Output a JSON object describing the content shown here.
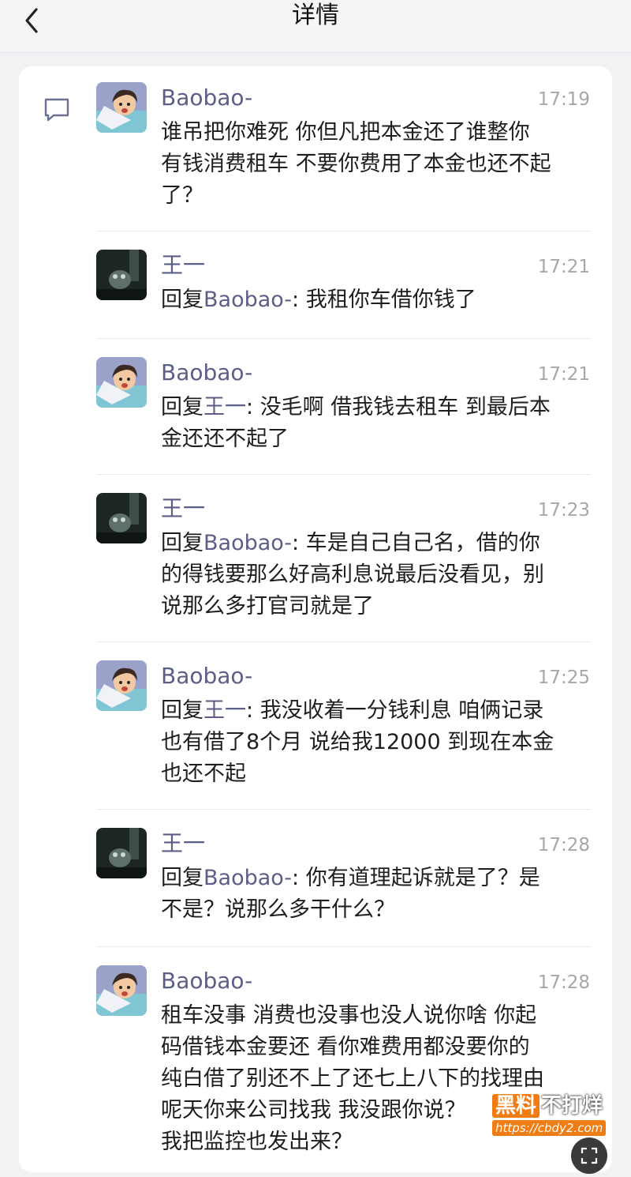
{
  "header": {
    "title": "详情"
  },
  "messages": [
    {
      "sender": "Baobao-",
      "time": "17:19",
      "avatar": "baobao",
      "reply_prefix": "",
      "reply_target": "",
      "reply_sep": "",
      "text": "谁吊把你难死 你但凡把本金还了谁整你\n有钱消费租车 不要你费用了本金也还不起\n了？"
    },
    {
      "sender": "王一",
      "time": "17:21",
      "avatar": "wangyi",
      "reply_prefix": "回复",
      "reply_target": "Baobao-",
      "reply_sep": ": ",
      "text": "我租你车借你钱了"
    },
    {
      "sender": "Baobao-",
      "time": "17:21",
      "avatar": "baobao",
      "reply_prefix": "回复",
      "reply_target": "王一",
      "reply_sep": ": ",
      "text": "没毛啊 借我钱去租车 到最后本\n金还还不起了"
    },
    {
      "sender": "王一",
      "time": "17:23",
      "avatar": "wangyi",
      "reply_prefix": "回复",
      "reply_target": "Baobao-",
      "reply_sep": ": ",
      "text": "车是自己自己名，借的你\n的得钱要那么好高利息说最后没看见，别\n说那么多打官司就是了"
    },
    {
      "sender": "Baobao-",
      "time": "17:25",
      "avatar": "baobao",
      "reply_prefix": "回复",
      "reply_target": "王一",
      "reply_sep": ": ",
      "text": "我没收着一分钱利息 咱俩记录\n也有借了8个月 说给我12000 到现在本金\n也还不起"
    },
    {
      "sender": "王一",
      "time": "17:28",
      "avatar": "wangyi",
      "reply_prefix": "回复",
      "reply_target": "Baobao-",
      "reply_sep": ": ",
      "text": "你有道理起诉就是了？是\n不是？说那么多干什么？"
    },
    {
      "sender": "Baobao-",
      "time": "17:28",
      "avatar": "baobao",
      "reply_prefix": "",
      "reply_target": "",
      "reply_sep": "",
      "text": "租车没事 消费也没事也没人说你啥 你起\n码借钱本金要还 看你难费用都没要你的\n纯白借了别还不上了还七上八下的找理由\n呢天你来公司找我 我没跟你说？\n我把监控也发出来？"
    }
  ],
  "watermark": {
    "brand_a": "黑料",
    "brand_b": "不打烊",
    "url": "https://cbdy2.com"
  },
  "icons": {
    "back": "chevron-left-icon",
    "comment": "comment-icon",
    "expand": "expand-icon"
  },
  "colors": {
    "name": "#5b5e86",
    "time": "#a6a6ac",
    "accent": "#f07d14"
  }
}
